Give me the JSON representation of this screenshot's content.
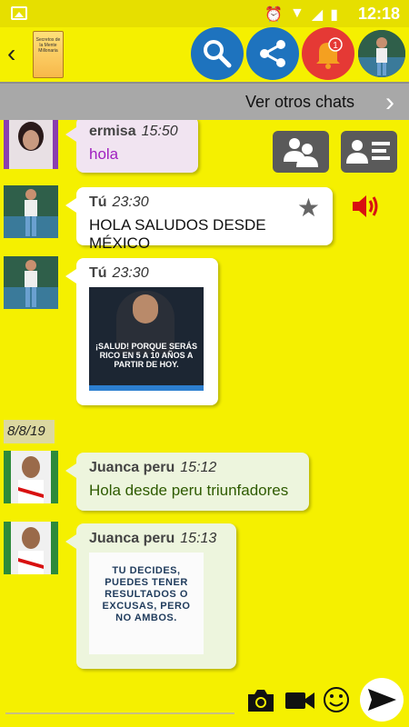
{
  "status": {
    "time": "12:18"
  },
  "header": {
    "back_label": "‹",
    "book_title": "Secretos de la Mente Millonaria",
    "notification_count": "1"
  },
  "subbar": {
    "label": "Ver otros chats"
  },
  "messages": [
    {
      "sender": "ermisa",
      "time": "15:50",
      "text": "hola"
    },
    {
      "sender": "Tú",
      "time": "23:30",
      "text": "HOLA SALUDOS DESDE MÉXICO"
    },
    {
      "sender": "Tú",
      "time": "23:30",
      "image_text": "¡SALUD! PORQUE SERÁS RICO EN 5 A 10 AÑOS A PARTIR DE HOY."
    },
    {
      "sender": "Juanca peru",
      "time": "15:12",
      "text": "Hola desde peru triunfadores"
    },
    {
      "sender": "Juanca peru",
      "time": "15:13",
      "image_text": "TU DECIDES, PUEDES TENER RESULTADOS O EXCUSAS, PERO NO AMBOS."
    }
  ],
  "date_separator": "8/8/19",
  "colors": {
    "background": "#f5f000",
    "accent_blue": "#1e73be",
    "bell_red": "#e53935"
  }
}
